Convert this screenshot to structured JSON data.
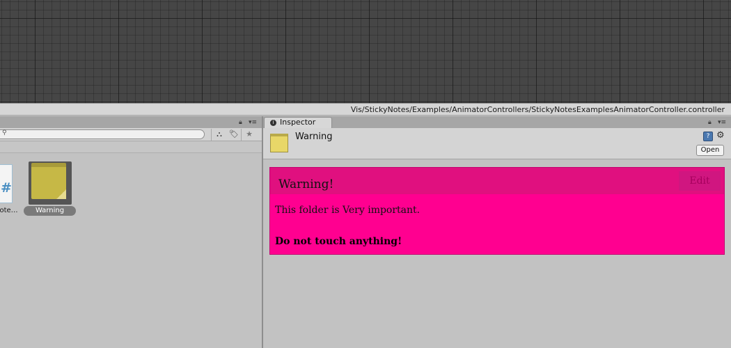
{
  "animator": {
    "path": "Vis/StickyNotes/Examples/AnimatorControllers/StickyNotesExamplesAnimatorController.controller"
  },
  "project": {
    "search": {
      "value": "",
      "placeholder": ""
    },
    "assets": [
      {
        "label": "Note…",
        "icon": "csharp-script-icon"
      },
      {
        "label": "Warning",
        "icon": "sticky-note-icon",
        "selected": true
      }
    ]
  },
  "inspector": {
    "tab_label": "Inspector",
    "object_name": "Warning",
    "open_label": "Open",
    "note": {
      "title": "Warning!",
      "edit_label": "Edit",
      "body": "This folder is Very important.",
      "emphasis": "Do not touch anything!",
      "colors": {
        "background": "#ff0090",
        "header": "#e0107f"
      }
    }
  }
}
